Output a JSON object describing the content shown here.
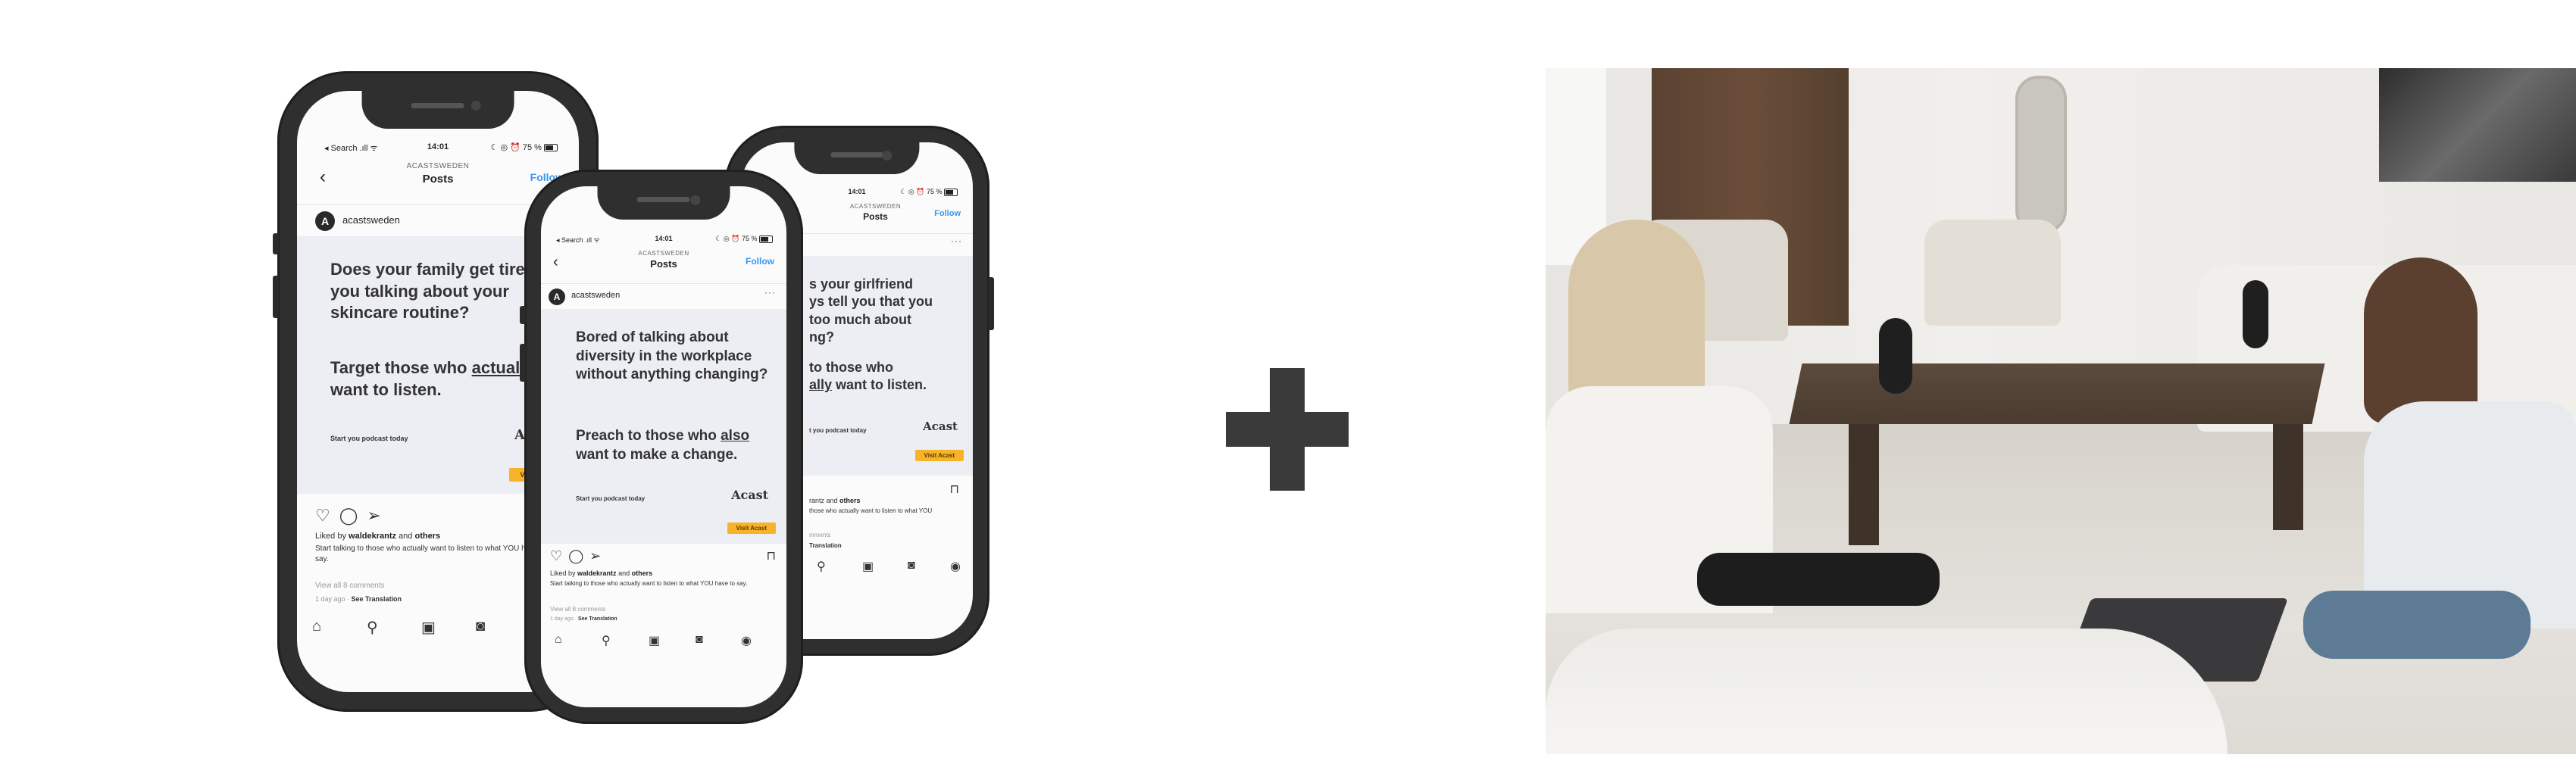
{
  "phones": [
    {
      "id": "left",
      "status_left": "◂ Search .ıll ᯤ",
      "status_time": "14:01",
      "status_right": "☾ ◎ ⏰ 75 %",
      "nav_back": "‹",
      "account_caps": "ACASTSWEDEN",
      "nav_title": "Posts",
      "follow": "Follow",
      "handle": "acastsweden",
      "avatar_letter": "A",
      "ad_question": "Does your family get tired of you talking about your skincare routine?",
      "ad_answer_pre": "Target those who ",
      "ad_answer_u": "actually ",
      "ad_answer_post": "want to listen.",
      "ad_start": "Start you podcast today",
      "ad_logo": "Acast",
      "ad_button": "Visit Acast",
      "liked_pre": "Liked by ",
      "liked_user": "waldekrantz",
      "liked_mid": " and ",
      "liked_others": "others",
      "caption": "Start talking to those who actually want to listen to what YOU have to say.",
      "view_comments": "View all 8 comments",
      "ago": "1 day ago · ",
      "see_translation": "See Translation"
    },
    {
      "id": "middle",
      "status_left": "◂ Search .ıll ᯤ",
      "status_time": "14:01",
      "status_right": "☾ ◎ ⏰ 75 %",
      "nav_back": "‹",
      "account_caps": "ACASTSWEDEN",
      "nav_title": "Posts",
      "follow": "Follow",
      "handle": "acastsweden",
      "avatar_letter": "A",
      "ad_question": "Bored of talking about diversity in the workplace without anything changing?",
      "ad_answer_pre": "Preach to those who ",
      "ad_answer_u": "also",
      "ad_answer_post": " want to make a change.",
      "ad_start": "Start you podcast today",
      "ad_logo": "Acast",
      "ad_button": "Visit Acast",
      "liked_pre": "Liked by ",
      "liked_user": "waldekrantz",
      "liked_mid": " and ",
      "liked_others": "others",
      "caption": "Start talking to those who actually want to listen to what YOU have to say.",
      "view_comments": "View all 8 comments",
      "ago": "1 day ago · ",
      "see_translation": "See Translation"
    },
    {
      "id": "right",
      "status_left": "",
      "status_time": "14:01",
      "status_right": "☾ ◎ ⏰ 75 %",
      "nav_back": "",
      "account_caps": "ACASTSWEDEN",
      "nav_title": "Posts",
      "follow": "Follow",
      "handle": "acastsweden",
      "avatar_letter": "",
      "ad_question": "Does your girlfriend always tell you that you talk too much about dating?",
      "ad_answer_pre": "Talk to those who ",
      "ad_answer_u": "actually",
      "ad_answer_post": " want to listen.",
      "ad_start": "Start you podcast today",
      "ad_logo": "Acast",
      "ad_button": "Visit Acast",
      "liked_pre": "Liked by ",
      "liked_user": "waldekrantz",
      "liked_mid": " and ",
      "liked_others": "others",
      "caption": "Start talking to those who actually want to listen to what YOU",
      "view_comments": "View all 8 comments",
      "ago": "",
      "see_translation": "See Translation"
    }
  ],
  "icons": {
    "heart": "♡",
    "comment": "◯",
    "share": "➢",
    "bookmark": "⊓",
    "home": "⌂",
    "search": "⚲",
    "reels": "▣",
    "shop": "◙",
    "profile": "◉",
    "more": "···"
  },
  "colors": {
    "ad_background": "#eceef4",
    "follow_blue": "#3897f0",
    "button_yellow": "#f6b42b",
    "phone_frame": "#2f2f2f",
    "plus": "#3a3a3a"
  }
}
